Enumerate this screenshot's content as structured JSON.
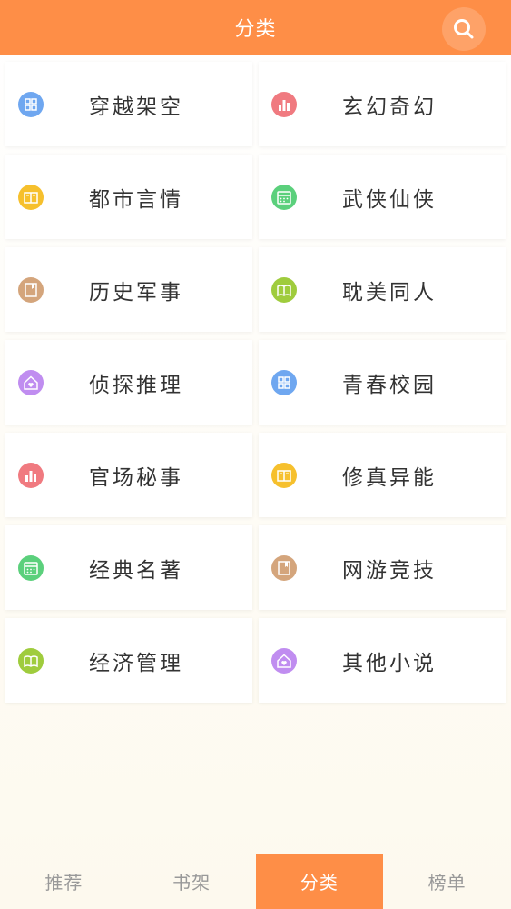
{
  "header": {
    "title": "分类"
  },
  "categories": [
    {
      "label": "穿越架空",
      "icon": "grid-icon",
      "color": "#6fa7f0"
    },
    {
      "label": "玄幻奇幻",
      "icon": "bar-chart-icon",
      "color": "#f07a80"
    },
    {
      "label": "都市言情",
      "icon": "book-icon",
      "color": "#f6c02d"
    },
    {
      "label": "武侠仙侠",
      "icon": "calendar-icon",
      "color": "#5bd07c"
    },
    {
      "label": "历史军事",
      "icon": "bookmark-icon",
      "color": "#d4a57c"
    },
    {
      "label": "耽美同人",
      "icon": "open-book-icon",
      "color": "#9fcc3d"
    },
    {
      "label": "侦探推理",
      "icon": "home-heart-icon",
      "color": "#c08df0"
    },
    {
      "label": "青春校园",
      "icon": "grid-icon",
      "color": "#6fa7f0"
    },
    {
      "label": "官场秘事",
      "icon": "bar-chart-icon",
      "color": "#f07a80"
    },
    {
      "label": "修真异能",
      "icon": "book-icon",
      "color": "#f6c02d"
    },
    {
      "label": "经典名著",
      "icon": "calendar-icon",
      "color": "#5bd07c"
    },
    {
      "label": "网游竞技",
      "icon": "bookmark-icon",
      "color": "#d4a57c"
    },
    {
      "label": "经济管理",
      "icon": "open-book-icon",
      "color": "#9fcc3d"
    },
    {
      "label": "其他小说",
      "icon": "home-heart-icon",
      "color": "#c08df0"
    }
  ],
  "tabs": [
    {
      "label": "推荐"
    },
    {
      "label": "书架"
    },
    {
      "label": "分类"
    },
    {
      "label": "榜单"
    }
  ],
  "colors": {
    "accent": "#fe8e47"
  }
}
